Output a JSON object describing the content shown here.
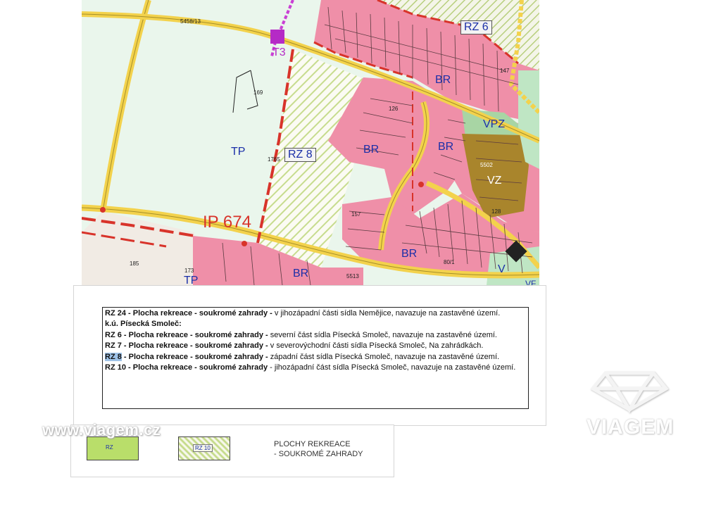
{
  "map": {
    "labels": {
      "rz6": "RZ 6",
      "rz8": "RZ 8",
      "br1": "BR",
      "br2": "BR",
      "br3": "BR",
      "br4": "BR",
      "br5": "BR",
      "tp1": "TP",
      "tp2": "TP",
      "vpz": "VPZ",
      "vz": "VZ",
      "v": "V",
      "vf": "VF",
      "ip": "IP 674",
      "t3": "T3"
    },
    "numbers": {
      "n1": "5458/13",
      "n2": "169",
      "n3": "185",
      "n4": "173",
      "n5": "5513",
      "n6": "157",
      "n7": "126",
      "n8": "5502",
      "n9": "128",
      "n10": "147",
      "n11": "80/1",
      "n12": "1765"
    },
    "colors": {
      "built_zone": "#ef8fa8",
      "garden_hatch": "#c7dc8e",
      "road": "#f3d24c",
      "background": "#eaf6ec",
      "park": "#a8d5a4",
      "water_zone": "#a9852c",
      "boundary": "#d8332a"
    }
  },
  "text_box": {
    "line1_bold": "RZ 24 - Plocha rekreace - soukromé zahrady -",
    "line1_text": " v jihozápadní části sídla Nemějice, navazuje na zastavěné území.",
    "line2_bold": "k.ú. Písecká Smoleč:",
    "line3_bold": "RZ 6 - Plocha rekreace - soukromé zahrady -",
    "line3_text": " severní část sídla Písecká Smoleč, navazuje na zastavěné území.",
    "line4_bold": "RZ 7 - Plocha rekreace - soukromé zahrady -",
    "line4_text": " v severovýchodní části sídla Písecká Smoleč, Na zahrádkách.",
    "line5_highlight": "RZ 8",
    "line5_bold": " - Plocha rekreace - soukromé zahrady -",
    "line5_text": " západní část sídla Písecká Smoleč, navazuje na zastavěné území.",
    "line6_bold": "RZ 10 - Plocha rekreace - soukromé zahrady",
    "line6_text": " - jihozápadní část sídla Písecká Smoleč, navazuje na zastavěné území."
  },
  "legend": {
    "swatch1_label": "RZ",
    "swatch2_label": "RZ 10",
    "text_line1": "PLOCHY REKREACE",
    "text_line2": "- SOUKROMÉ ZAHRADY"
  },
  "watermarks": {
    "site": "www.viagem.cz",
    "brand": "VIAGEM"
  }
}
